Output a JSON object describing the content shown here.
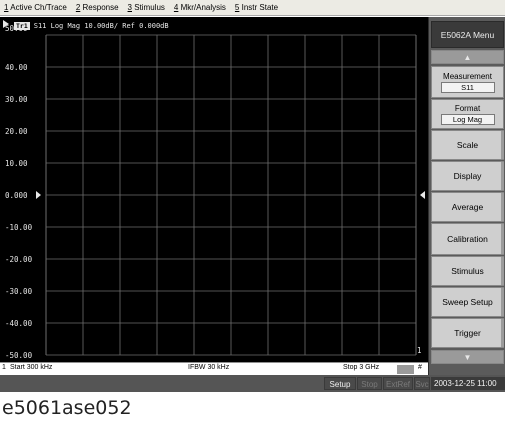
{
  "menubar": {
    "items": [
      {
        "accel": "1",
        "label": " Active Ch/Trace"
      },
      {
        "accel": "2",
        "label": " Response"
      },
      {
        "accel": "3",
        "label": " Stimulus"
      },
      {
        "accel": "4",
        "label": " Mkr/Analysis"
      },
      {
        "accel": "5",
        "label": " Instr State"
      }
    ]
  },
  "trace": {
    "badge": "Tr1",
    "header": "S11 Log Mag 10.00dB/ Ref 0.000dB",
    "trace_number": "1"
  },
  "plot": {
    "y_labels": [
      "50.00",
      "40.00",
      "30.00",
      "20.00",
      "10.00",
      "0.000",
      "-10.00",
      "-20.00",
      "-30.00",
      "-40.00",
      "-50.00"
    ],
    "y_range": [
      -50,
      50
    ],
    "y_divisions": 10,
    "x_divisions": 10,
    "ref_level": 0,
    "grid_color": "#6e6e6e",
    "grid": true
  },
  "statusline": {
    "channel": "1",
    "start": "Start 300 kHz",
    "ifbw": "IFBW 30 kHz",
    "stop": "Stop 3 GHz",
    "stop_badge": "",
    "hash": "#"
  },
  "bottombar": {
    "setup": "Setup",
    "stop": "Stop",
    "extref": "ExtRef",
    "svc": "Svc",
    "datetime": "2003-12-25 11:00"
  },
  "softkeys": {
    "title": "E5062A Menu",
    "up_arrow": "▲",
    "down_arrow": "▼",
    "measurement_label": "Measurement",
    "measurement_value": "S11",
    "format_label": "Format",
    "format_value": "Log Mag",
    "scale": "Scale",
    "display": "Display",
    "average": "Average",
    "calibration": "Calibration",
    "stimulus": "Stimulus",
    "sweep_setup": "Sweep Setup",
    "trigger": "Trigger"
  },
  "caption": "e5061ase052"
}
